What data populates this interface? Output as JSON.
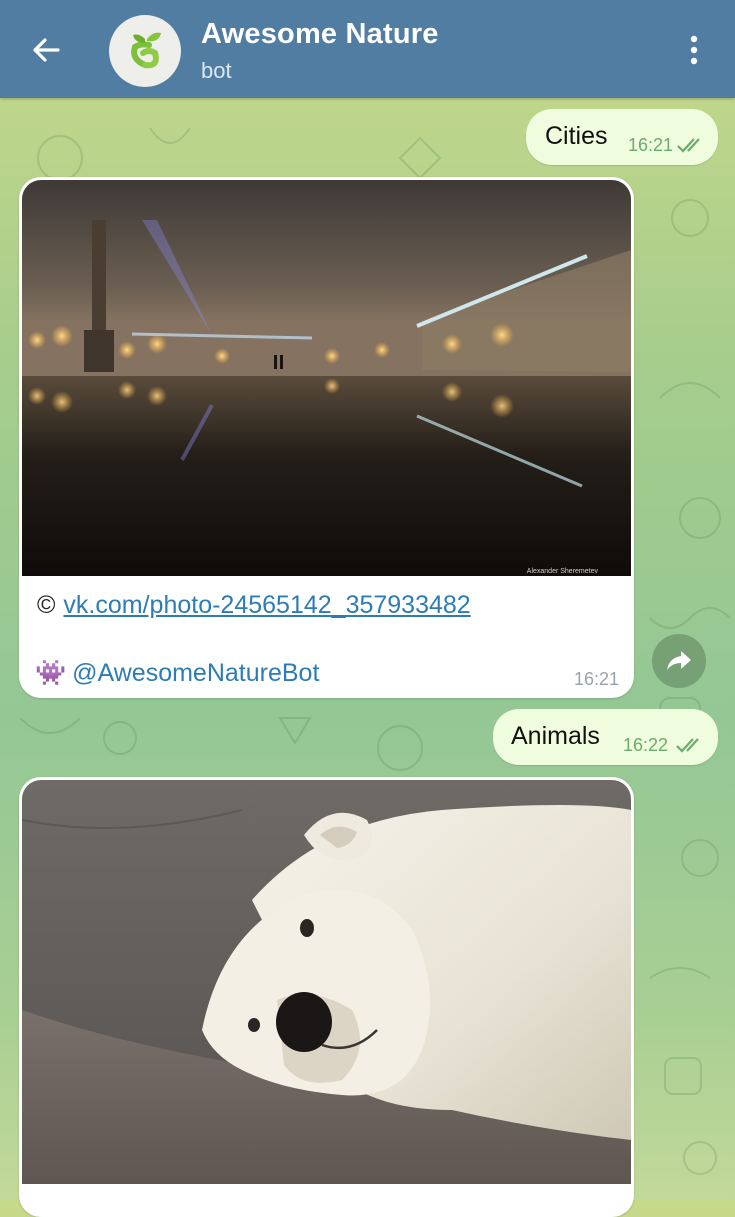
{
  "header": {
    "title": "Awesome Nature",
    "subtitle": "bot"
  },
  "messages": {
    "out1": {
      "text": "Cities",
      "time": "16:21"
    },
    "in1": {
      "photo_credit": "Alexander Sheremetev",
      "copyright_symbol": "©",
      "link": "vk.com/photo-24565142_357933482",
      "mention_emoji": "👾",
      "mention": "@AwesomeNatureBot",
      "time": "16:21"
    },
    "out2": {
      "text": "Animals",
      "time": "16:22"
    }
  },
  "colors": {
    "header_bg": "#517da2",
    "out_bubble": "#effdde",
    "link": "#2e7cb5",
    "read_checks": "#6bab6d"
  }
}
